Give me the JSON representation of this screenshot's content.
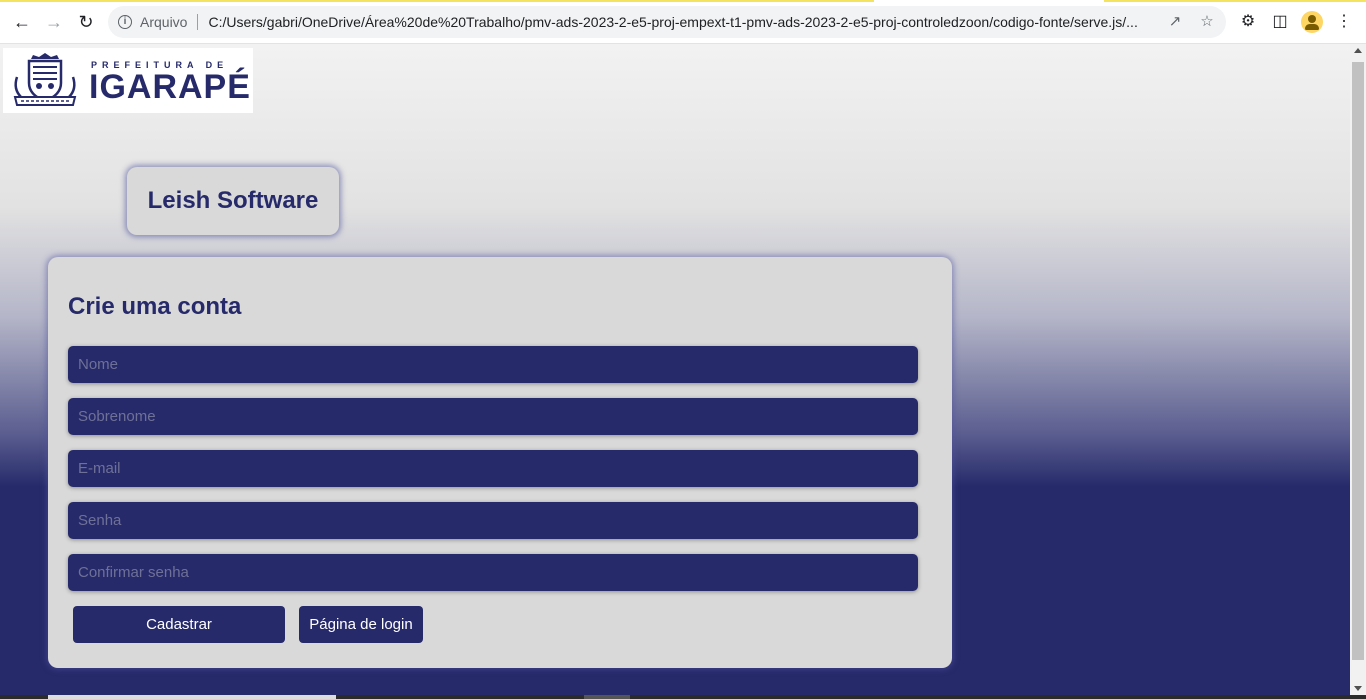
{
  "browser": {
    "scheme_label": "Arquivo",
    "url": "C:/Users/gabri/OneDrive/Área%20de%20Trabalho/pmv-ads-2023-2-e5-proj-empext-t1-pmv-ads-2023-2-e5-proj-controledzoon/codigo-fonte/serve.js/..."
  },
  "logo": {
    "top_text": "PREFEITURA DE",
    "main_text": "IGARAPÉ"
  },
  "brand": {
    "title": "Leish Software"
  },
  "form": {
    "title": "Crie uma conta",
    "fields": {
      "nome": "Nome",
      "sobrenome": "Sobrenome",
      "email": "E-mail",
      "senha": "Senha",
      "confirmar": "Confirmar senha"
    },
    "buttons": {
      "register": "Cadastrar",
      "login": "Página de login"
    }
  },
  "colors": {
    "primary": "#262a6a",
    "card": "#d9d9d9"
  }
}
